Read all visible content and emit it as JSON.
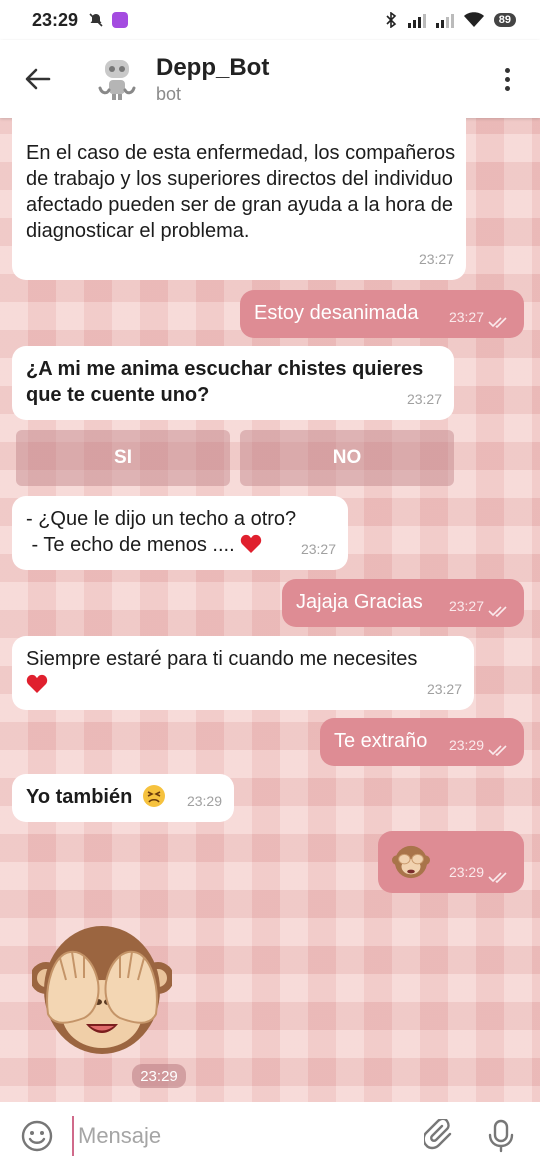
{
  "status": {
    "time": "23:29",
    "battery": "89"
  },
  "header": {
    "title": "Depp_Bot",
    "subtitle": "bot"
  },
  "messages": [
    {
      "dir": "in",
      "text": "En el caso de esta enfermedad, los compañeros de trabajo y los superiores directos del individuo afectado pueden ser de gran ayuda a la hora de diagnosticar el problema.",
      "time": "23:27"
    },
    {
      "dir": "out",
      "text": "Estoy desanimada",
      "time": "23:27"
    },
    {
      "dir": "in",
      "text": "¿A mi me anima escuchar chistes quieres que te cuente uno?",
      "time": "23:27"
    },
    {
      "dir": "in",
      "line1": "- ¿Que le dijo un techo a otro?",
      "line2": " - Te echo de menos ....",
      "time": "23:27"
    },
    {
      "dir": "out",
      "text": "Jajaja Gracias",
      "time": "23:27"
    },
    {
      "dir": "in",
      "text": "Siempre estaré para ti cuando me necesites",
      "time": "23:27"
    },
    {
      "dir": "out",
      "text": "Te extraño",
      "time": "23:29"
    },
    {
      "dir": "in",
      "text": "Yo también",
      "time": "23:29"
    },
    {
      "dir": "out",
      "emoji": "see-no-evil-monkey",
      "time": "23:29"
    },
    {
      "dir": "in",
      "sticker": "see-no-evil-monkey-sticker",
      "time": "23:29"
    }
  ],
  "keyboard": {
    "yes": "SI",
    "no": "NO"
  },
  "input": {
    "placeholder": "Mensaje"
  },
  "colors": {
    "outgoing": "#de8c94",
    "incoming": "#ffffff",
    "background": "#f3c9c7"
  }
}
